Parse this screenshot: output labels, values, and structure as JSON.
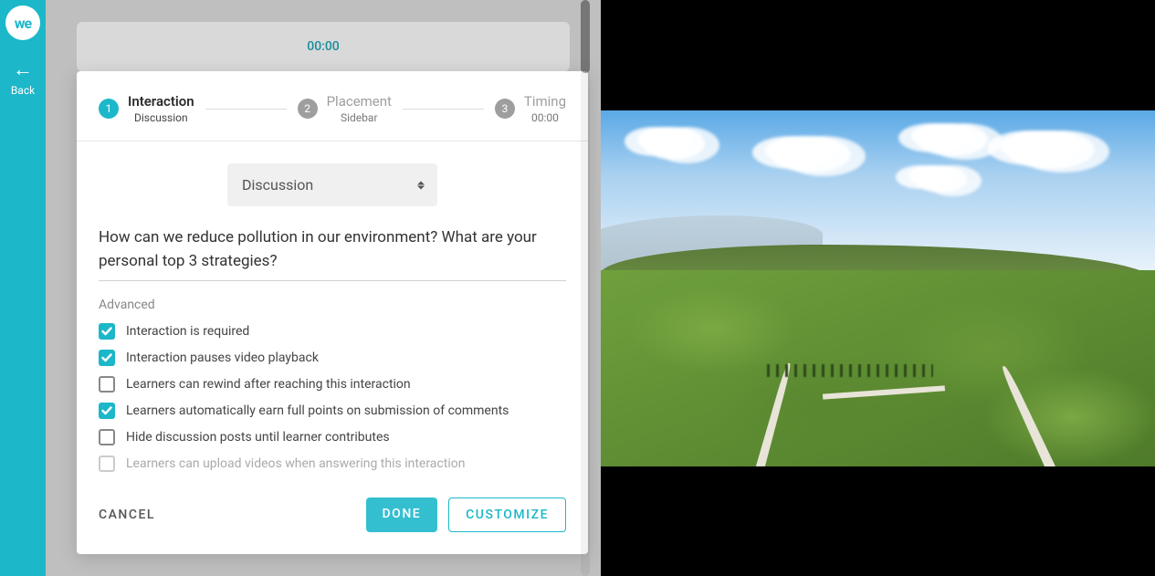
{
  "rail": {
    "logo_text": "we",
    "back_label": "Back"
  },
  "timer": "00:00",
  "stepper": {
    "steps": [
      {
        "num": "1",
        "title": "Interaction",
        "sub": "Discussion"
      },
      {
        "num": "2",
        "title": "Placement",
        "sub": "Sidebar"
      },
      {
        "num": "3",
        "title": "Timing",
        "sub": "00:00"
      }
    ]
  },
  "select": {
    "value": "Discussion"
  },
  "prompt": "How can we reduce pollution in our environment? What are your personal top 3 strategies?",
  "advanced_label": "Advanced",
  "options": [
    {
      "label": "Interaction is required",
      "checked": true,
      "disabled": false
    },
    {
      "label": "Interaction pauses video playback",
      "checked": true,
      "disabled": false
    },
    {
      "label": "Learners can rewind after reaching this interaction",
      "checked": false,
      "disabled": false
    },
    {
      "label": "Learners automatically earn full points on submission of comments",
      "checked": true,
      "disabled": false
    },
    {
      "label": "Hide discussion posts until learner contributes",
      "checked": false,
      "disabled": false
    },
    {
      "label": "Learners can upload videos when answering this interaction",
      "checked": false,
      "disabled": true
    }
  ],
  "footer": {
    "cancel": "CANCEL",
    "done": "DONE",
    "customize": "CUSTOMIZE"
  }
}
